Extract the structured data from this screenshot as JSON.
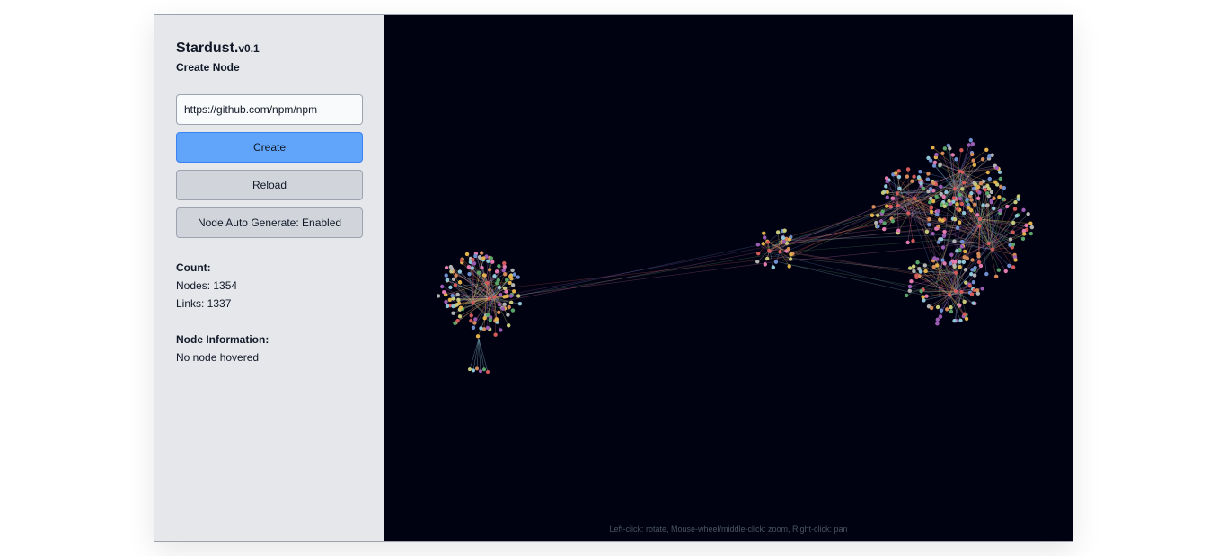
{
  "app": {
    "title": "Stardust.",
    "version": "v0.1",
    "subtitle": "Create Node"
  },
  "form": {
    "url_value": "https://github.com/npm/npm",
    "create_label": "Create",
    "reload_label": "Reload",
    "auto_generate_label": "Node Auto Generate: Enabled"
  },
  "count": {
    "heading": "Count:",
    "nodes_text": "Nodes: 1354",
    "links_text": "Links: 1337"
  },
  "node_info": {
    "heading": "Node Information:",
    "status": "No node hovered"
  },
  "canvas": {
    "hint": "Left-click: rotate, Mouse-wheel/middle-click: zoom, Right-click: pan",
    "background": "#000211",
    "node_palette": [
      "#c7c97a",
      "#8ec5d6",
      "#d58a5a",
      "#9b5cb3",
      "#5aa469",
      "#d45a5a",
      "#e0b04a",
      "#6f8fcf",
      "#b2b2b2",
      "#e07ab0"
    ]
  },
  "colors": {
    "sidebar_bg": "#e5e7eb",
    "primary_button": "#60a5fa",
    "secondary_button": "#d1d5db"
  }
}
